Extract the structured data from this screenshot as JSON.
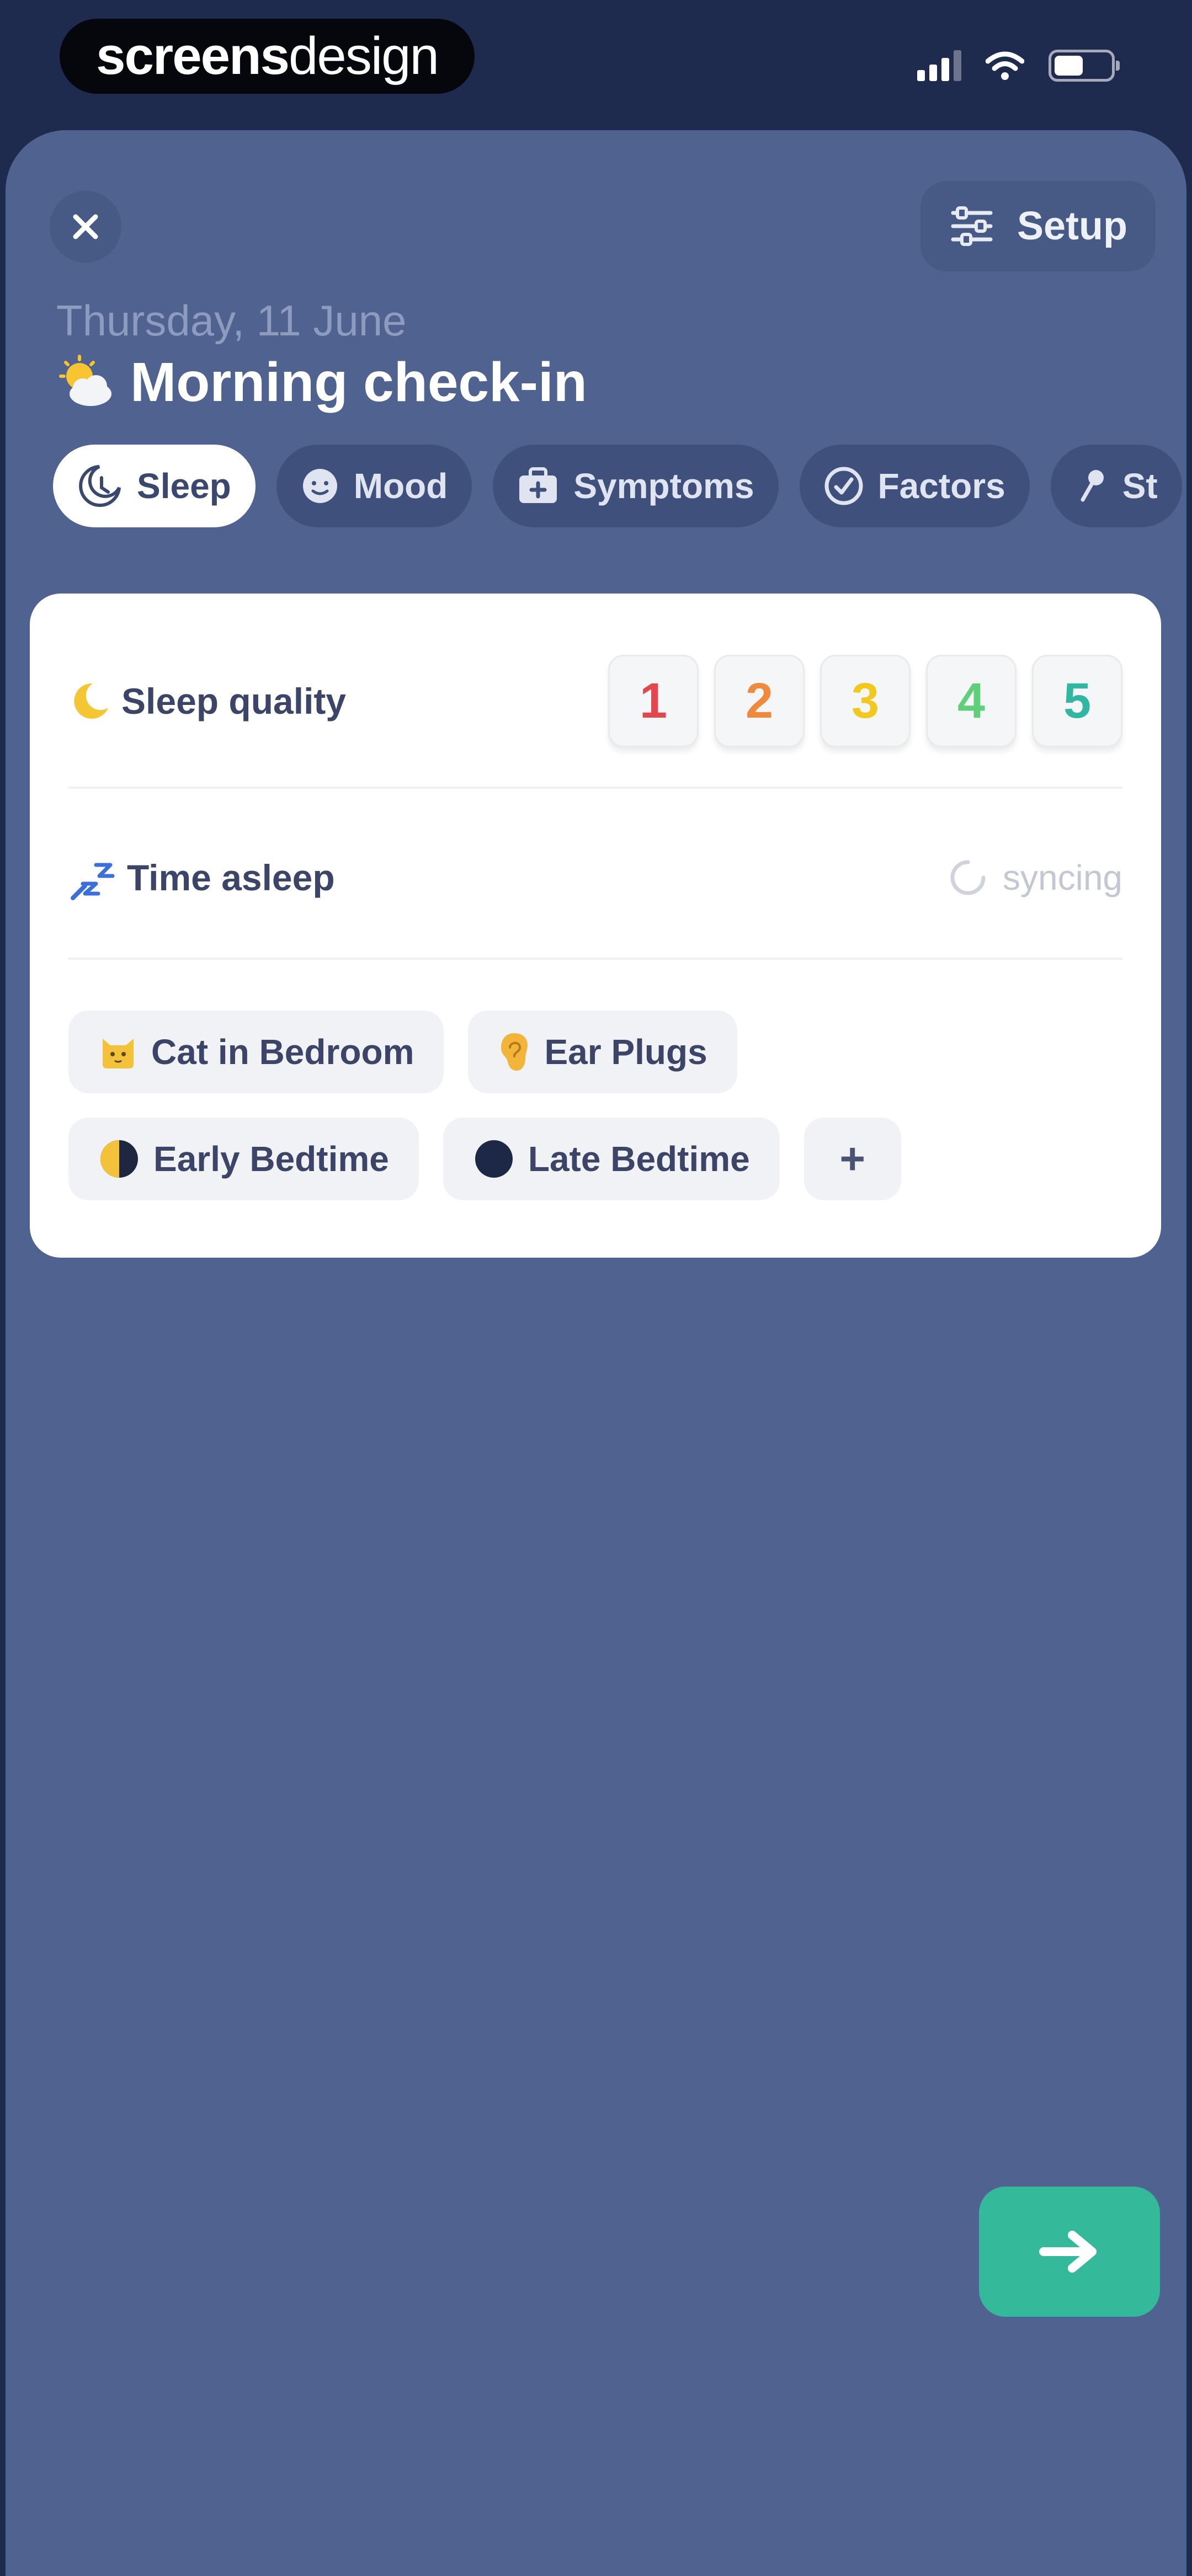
{
  "status_bar": {
    "brand_part1": "screens",
    "brand_part2": "design"
  },
  "header": {
    "setup_label": "Setup",
    "date": "Thursday, 11 June",
    "title": "Morning check-in"
  },
  "tabs": [
    {
      "label": "Sleep",
      "icon": "moon-clock-icon",
      "active": true
    },
    {
      "label": "Mood",
      "icon": "face-icon",
      "active": false
    },
    {
      "label": "Symptoms",
      "icon": "medical-kit-icon",
      "active": false
    },
    {
      "label": "Factors",
      "icon": "factors-icon",
      "active": false
    },
    {
      "label": "St",
      "icon": "pin-icon",
      "active": false
    }
  ],
  "sleep_card": {
    "quality_label": "Sleep quality",
    "ratings": [
      {
        "value": "1",
        "color": "#e2474f"
      },
      {
        "value": "2",
        "color": "#ee8a3e"
      },
      {
        "value": "3",
        "color": "#f2c81e"
      },
      {
        "value": "4",
        "color": "#5fcf7a"
      },
      {
        "value": "5",
        "color": "#2fb7a1"
      }
    ],
    "asleep_label": "Time asleep",
    "syncing_label": "syncing",
    "tags": [
      {
        "label": "Cat in Bedroom",
        "icon": "cat-icon"
      },
      {
        "label": "Ear Plugs",
        "icon": "ear-icon"
      },
      {
        "label": "Early Bedtime",
        "icon": "half-moon-icon"
      },
      {
        "label": "Late Bedtime",
        "icon": "new-moon-icon"
      }
    ],
    "add_label": "+"
  },
  "colors": {
    "sheet_bg": "#4f6290",
    "accent_next": "#34b99a"
  }
}
